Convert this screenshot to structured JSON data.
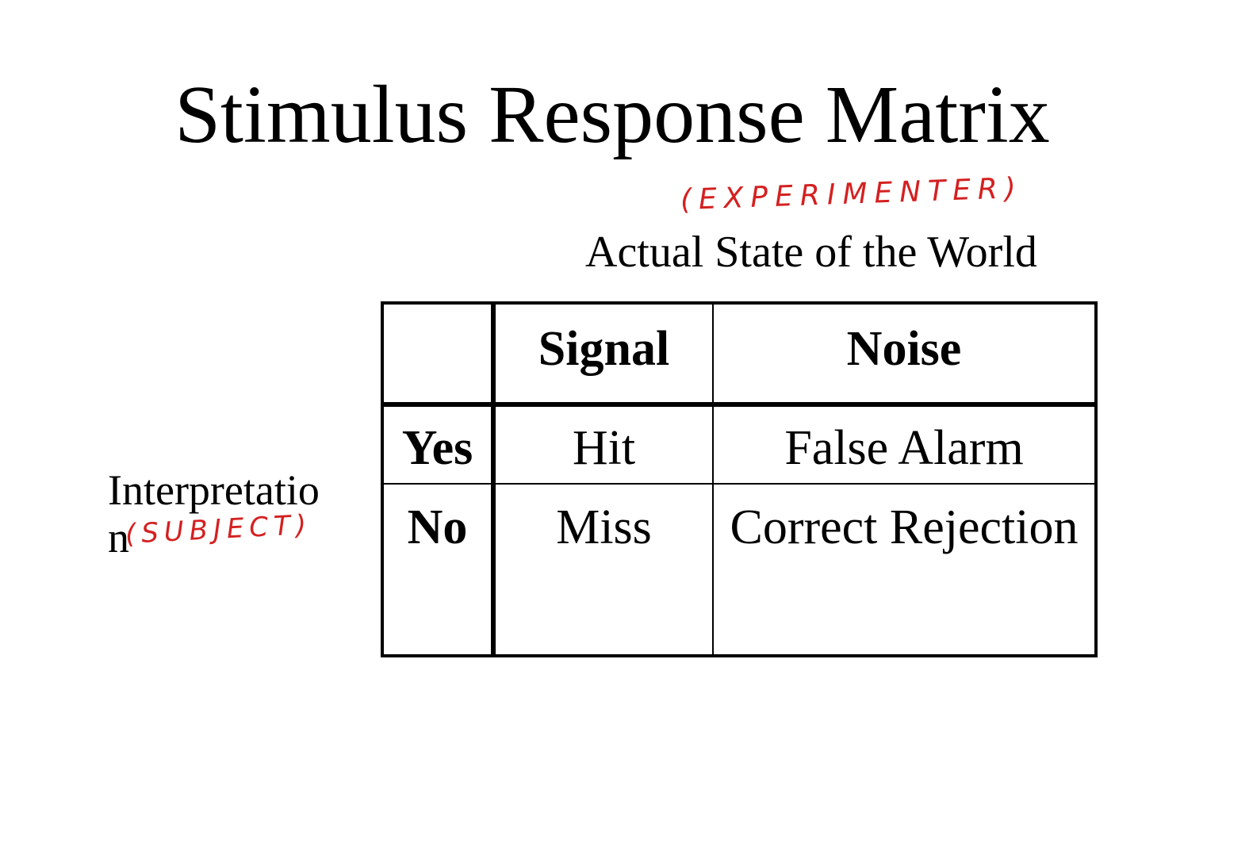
{
  "slide": {
    "title": "Stimulus Response Matrix",
    "column_axis_label": "Actual State of the World",
    "row_axis_label": "Interpretation",
    "annotations": {
      "column_axis_note": "(EXPERIMENTER)",
      "row_axis_note": "(SUBJECT)",
      "color": "#d42020"
    }
  },
  "matrix": {
    "corner": "",
    "columns": [
      "Signal",
      "Noise"
    ],
    "rows": [
      {
        "label": "Yes",
        "cells": [
          "Hit",
          "False Alarm"
        ]
      },
      {
        "label": "No",
        "cells": [
          "Miss",
          "Correct Rejection"
        ]
      }
    ]
  }
}
